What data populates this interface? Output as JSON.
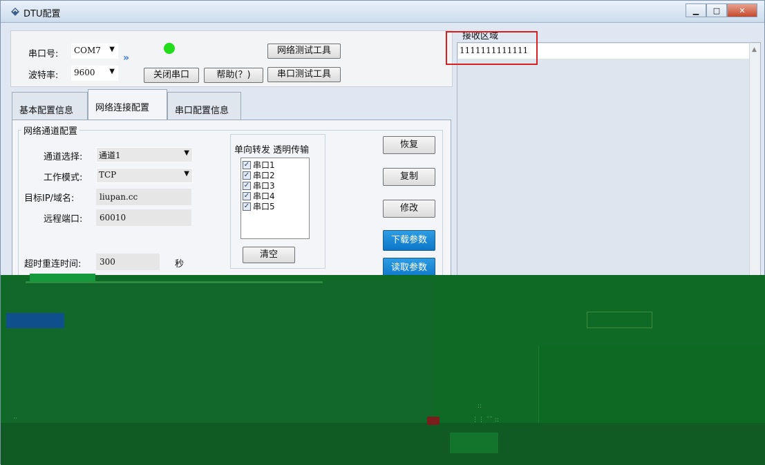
{
  "window": {
    "title": "DTU配置"
  },
  "serial": {
    "port_label": "串口号:",
    "port_value": "COM7",
    "baud_label": "波特率:",
    "baud_value": "9600",
    "status_color": "#22dd1a",
    "net_test_button": "网络测试工具",
    "close_port_button": "关闭串口",
    "help_button": "帮助(？)",
    "serial_test_button": "串口测试工具"
  },
  "tabs": [
    {
      "label": "基本配置信息"
    },
    {
      "label": "网络连接配置"
    },
    {
      "label": "串口配置信息"
    }
  ],
  "network": {
    "group_title": "网络通道配置",
    "channel_label": "通道选择:",
    "channel_value": "通道1",
    "mode_label": "工作模式:",
    "mode_value": "TCP",
    "target_label": "目标IP/域名:",
    "target_value": "liupan.cc",
    "port_label": "远程端口:",
    "port_value": "60010",
    "timeout_label": "超时重连时间:",
    "timeout_value": "300",
    "timeout_unit": "秒",
    "forward_title": "单向转发 透明传输",
    "serial_list": [
      "串口1",
      "串口2",
      "串口3",
      "串口4",
      "串口5"
    ],
    "clear_button": "清空"
  },
  "actions": {
    "restore": "恢复",
    "copy": "复制",
    "modify": "修改",
    "download": "下载参数",
    "read": "读取参数"
  },
  "receive": {
    "label": "接收区域",
    "content": "1111111111111"
  }
}
